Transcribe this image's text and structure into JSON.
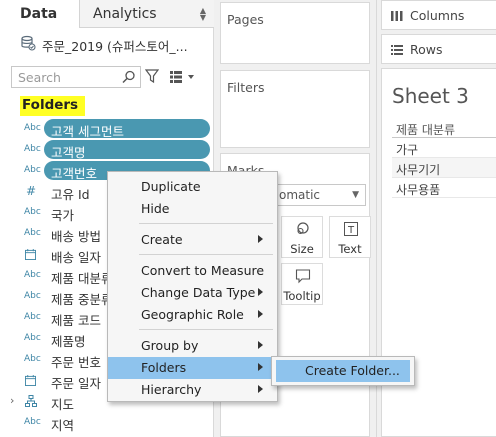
{
  "tabs": {
    "data": "Data",
    "analytics": "Analytics"
  },
  "datasource": {
    "name": "주문_2019 (슈퍼스토어_..."
  },
  "search": {
    "placeholder": "Search"
  },
  "folders_header": "Folders",
  "fields": [
    {
      "type": "Abc",
      "name": "고객 세그먼트",
      "selected": true
    },
    {
      "type": "Abc",
      "name": "고객명",
      "selected": true
    },
    {
      "type": "Abc",
      "name": "고객번호",
      "selected": true
    },
    {
      "type": "#",
      "name": "고유 Id"
    },
    {
      "type": "Abc",
      "name": "국가"
    },
    {
      "type": "Abc",
      "name": "배송 방법"
    },
    {
      "type": "calendar",
      "name": "배송 일자"
    },
    {
      "type": "Abc",
      "name": "제품 대분류"
    },
    {
      "type": "Abc",
      "name": "제품 중분류"
    },
    {
      "type": "Abc",
      "name": "제품 코드"
    },
    {
      "type": "Abc",
      "name": "제품명"
    },
    {
      "type": "Abc",
      "name": "주문 번호"
    },
    {
      "type": "calendar",
      "name": "주문 일자"
    },
    {
      "type": "hierarchy",
      "name": "지도",
      "expander": "›"
    },
    {
      "type": "Abc",
      "name": "지역"
    }
  ],
  "cards": {
    "pages": "Pages",
    "filters": "Filters",
    "marks": "Marks"
  },
  "marks": {
    "type_value": "omatic",
    "size_label": "Size",
    "text_label": "Text",
    "tooltip_label": "Tooltip"
  },
  "shelves": {
    "columns": "Columns",
    "rows": "Rows"
  },
  "sheet": {
    "title": "Sheet 3",
    "header": "제품 대분류",
    "rows": [
      "가구",
      "사무기기",
      "사무용품"
    ]
  },
  "context_menu": {
    "items": [
      {
        "label": "Duplicate"
      },
      {
        "label": "Hide"
      },
      {
        "label": "Create",
        "submenu": true
      },
      {
        "label": "Convert to Measure"
      },
      {
        "label": "Change Data Type",
        "submenu": true
      },
      {
        "label": "Geographic Role",
        "submenu": true
      },
      {
        "label": "Group by",
        "submenu": true
      },
      {
        "label": "Folders",
        "submenu": true,
        "highlighted": true
      },
      {
        "label": "Hierarchy",
        "submenu": true
      }
    ]
  },
  "submenu": {
    "create_folder": "Create Folder..."
  },
  "colors": {
    "pill": "#4a98b1",
    "highlight": "#8ec3ed",
    "folders_header_bg": "#ffff24",
    "type_icon": "#3f86a6"
  }
}
